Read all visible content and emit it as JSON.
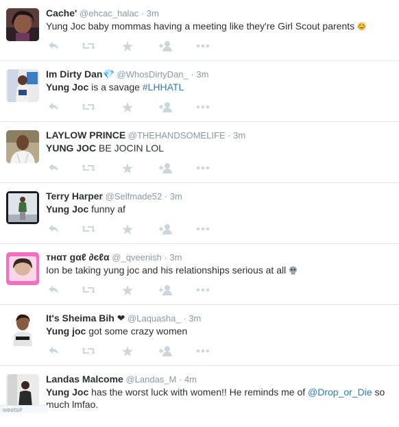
{
  "tweets": [
    {
      "name": "Cache'",
      "handle": "@ehcac_halac",
      "dot": "·",
      "time": "3m",
      "text_parts": [
        "Yung Joc baby mommas having a meeting like they're Girl Scout parents "
      ],
      "emoji": "tears-of-joy-emoji"
    },
    {
      "name": "Im Dirty Dan💎",
      "handle": "@WhosDirtyDan_",
      "dot": "·",
      "time": "3m",
      "kw": "Yung Joc",
      "rest": " is a savage ",
      "link": "#LHHATL"
    },
    {
      "name": "LAYLOW PRINCE",
      "handle": "@THEHANDSOMELIFE",
      "dot": "·",
      "time": "3m",
      "kw": "YUNG JOC",
      "rest": " BE JOCIN LOL"
    },
    {
      "name": "Terry Harper",
      "handle": "@Selfmade52",
      "dot": "·",
      "time": "3m",
      "kw": "Yung Joc",
      "rest": " funny af"
    },
    {
      "name": "тнαт gαℓ ∂єℓα",
      "handle": "@_qveenish",
      "dot": "·",
      "time": "3m",
      "text": "Ion be taking yung joc and his relationships serious at all ",
      "emoji": "skull-emoji"
    },
    {
      "name": "It's Sheima Bih ❤",
      "handle": "@Laquasha_",
      "dot": "·",
      "time": "3m",
      "kw": "Yung joc",
      "rest": " got some crazy women"
    },
    {
      "name": "Landas Malcome",
      "handle": "@Landas_M",
      "dot": "·",
      "time": "4m",
      "kw": "Yung Joc",
      "rest": " has the worst luck with women!! He reminds me of ",
      "link": "@Drop_or_Die",
      "rest2": " so much lmfao."
    }
  ],
  "footer_text": "weets#",
  "icons": {
    "reply": "reply-icon",
    "retweet": "retweet-icon",
    "favorite": "star-icon",
    "follow": "follow-icon",
    "more": "more-icon"
  },
  "colors": {
    "action_gray": "#ccd6dd",
    "link_blue": "#2b7bb9",
    "muted": "#8899a6"
  }
}
